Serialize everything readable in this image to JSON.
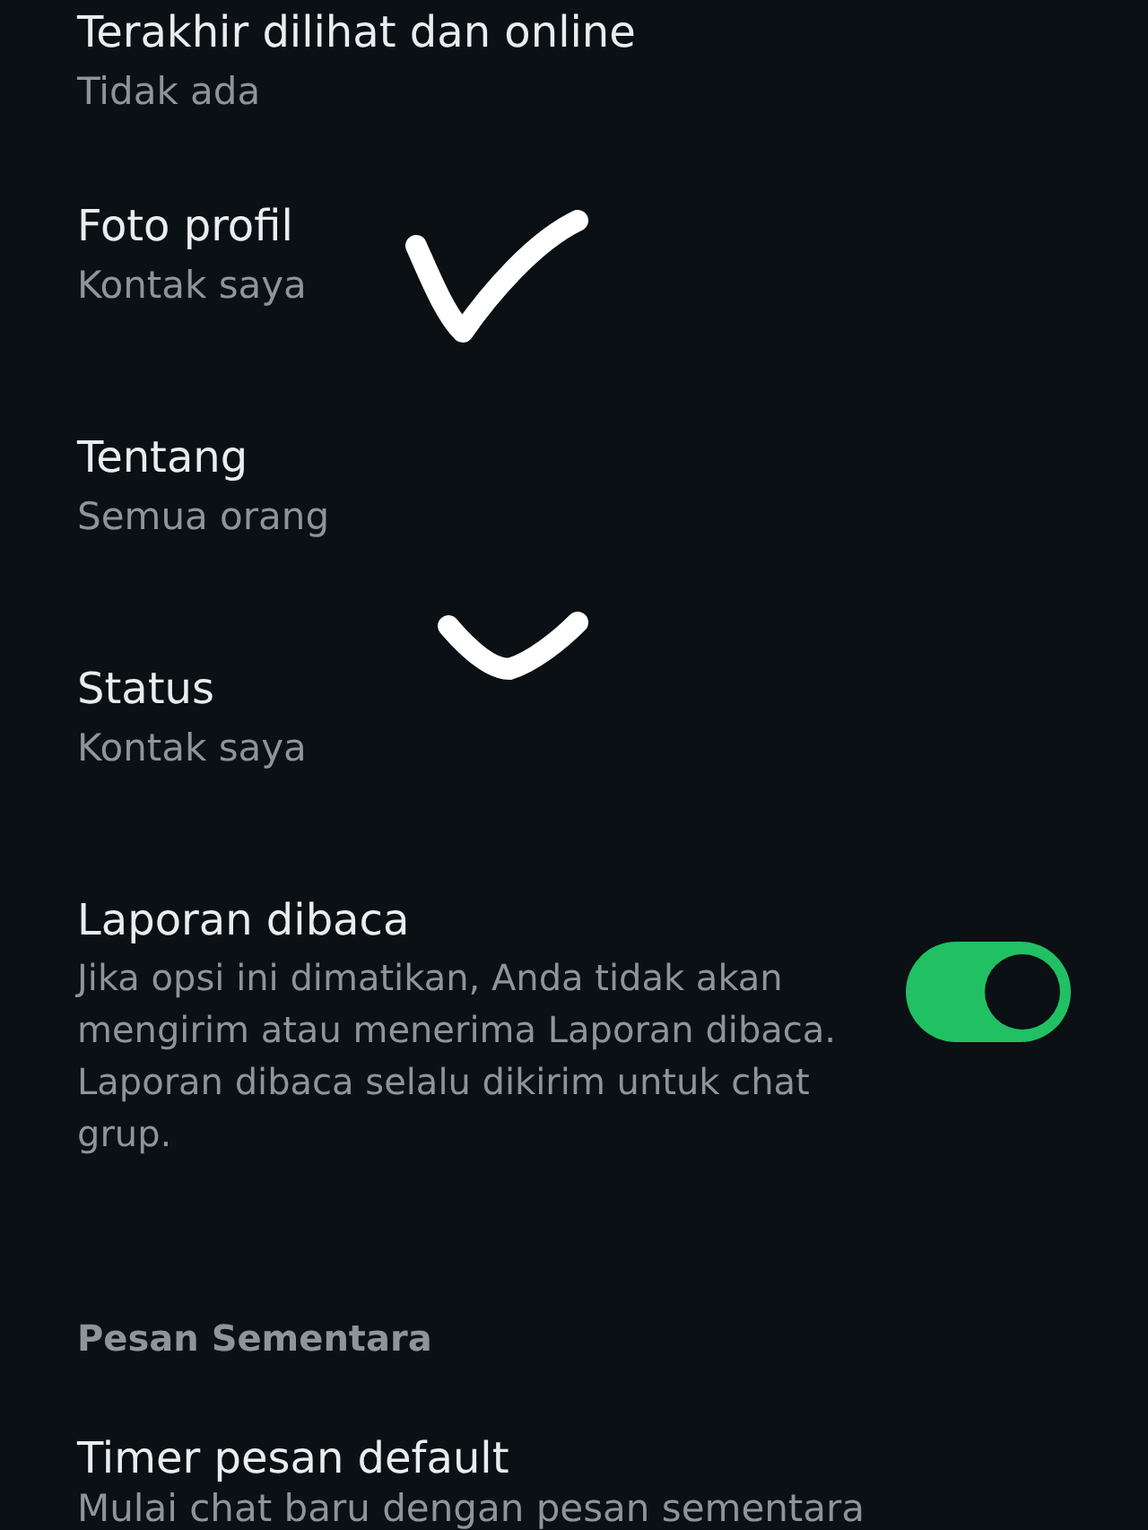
{
  "privacy_items": [
    {
      "title": "Terakhir dilihat dan online",
      "value": "Tidak ada",
      "annotated": false
    },
    {
      "title": "Foto profil",
      "value": "Kontak saya",
      "annotated": true
    },
    {
      "title": "Tentang",
      "value": "Semua orang",
      "annotated": false
    },
    {
      "title": "Status",
      "value": "Kontak saya",
      "annotated": true
    }
  ],
  "read_receipts": {
    "title": "Laporan dibaca",
    "description": "Jika opsi ini dimatikan, Anda tidak akan mengirim atau menerima Laporan dibaca. Laporan dibaca selalu dikirim untuk chat grup.",
    "on": true
  },
  "section": {
    "title": "Pesan Sementara",
    "items": [
      {
        "title": "Timer pesan default",
        "description": "Mulai chat baru dengan pesan sementara"
      }
    ]
  }
}
